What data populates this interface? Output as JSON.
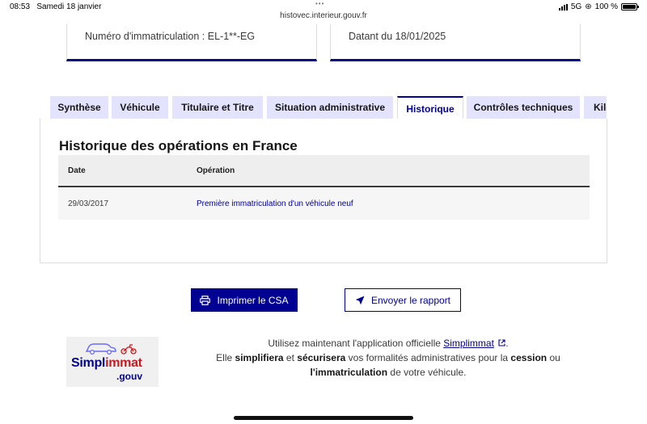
{
  "status_bar": {
    "time": "08:53",
    "date": "Samedi 18 janvier",
    "url": "histovec.interieur.gouv.fr",
    "network": "5G",
    "battery": "100 %"
  },
  "cards": [
    {
      "text": "Numéro d'immatriculation : EL-1**-EG"
    },
    {
      "text": "Datant du 18/01/2025"
    }
  ],
  "tabs": [
    {
      "label": "Synthèse"
    },
    {
      "label": "Véhicule"
    },
    {
      "label": "Titulaire et Titre"
    },
    {
      "label": "Situation administrative"
    },
    {
      "label": "Historique"
    },
    {
      "label": "Contrôles techniques"
    },
    {
      "label": "Kilo"
    }
  ],
  "history": {
    "title": "Historique des opérations en France",
    "columns": [
      "Date",
      "Opération"
    ],
    "rows": [
      {
        "date": "29/03/2017",
        "operation": "Première immatriculation d'un véhicule neuf"
      }
    ]
  },
  "buttons": {
    "print": "Imprimer le CSA",
    "send": "Envoyer le rapport"
  },
  "promo": {
    "logo_main": "Simpl",
    "logo_accent": "immat",
    "logo_suffix": ".gouv",
    "line1_before": "Utilisez maintenant l'application officielle",
    "link": "Simplimmat",
    "line1_after": ".",
    "line2_a": "Elle",
    "line2_b": "simplifiera",
    "line2_c": "et",
    "line2_d": "sécurisera",
    "line2_e": "vos formalités administratives pour la",
    "line2_f": "cession",
    "line2_g": "ou",
    "line3_a": "l'immatriculation",
    "line3_b": "de votre véhicule."
  },
  "colors": {
    "accent": "#000091",
    "tab_inactive": "#e3e3fd",
    "logo_red": "#c9191e"
  }
}
